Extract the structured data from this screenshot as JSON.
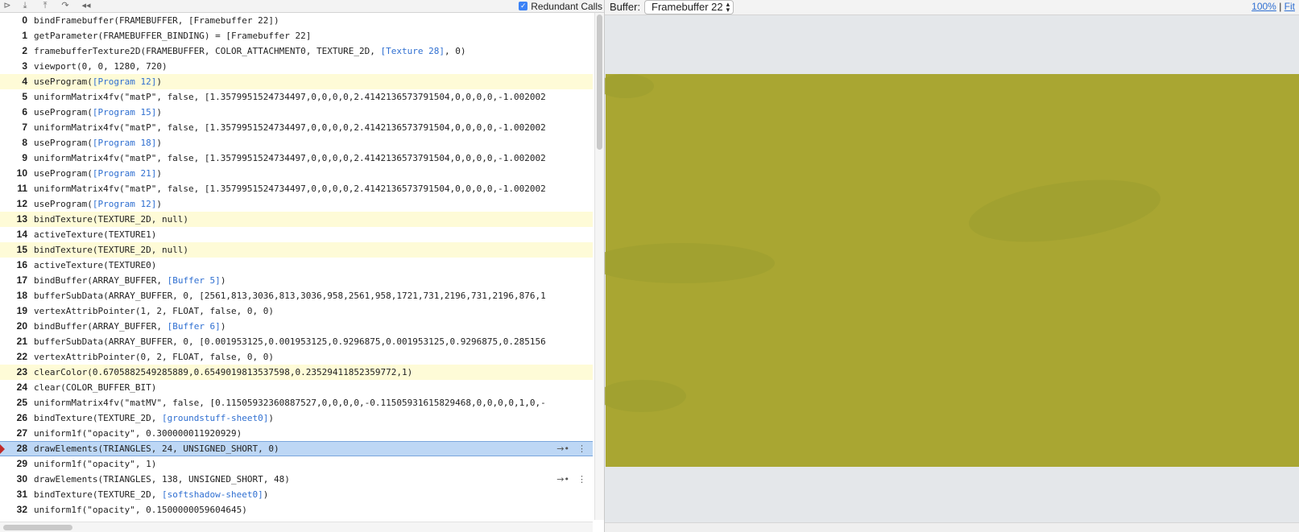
{
  "toolbar": {
    "buttons": [
      "step-forward-icon",
      "step-into-icon",
      "step-out-icon",
      "redo-icon",
      "rewind-icon"
    ],
    "redundant_calls_label": "Redundant Calls",
    "redundant_calls_checked": true
  },
  "calls": [
    {
      "num": "0",
      "code": [
        {
          "t": "bindFramebuffer(FRAMEBUFFER, [Framebuffer 22])"
        }
      ]
    },
    {
      "num": "1",
      "code": [
        {
          "t": "getParameter(FRAMEBUFFER_BINDING) = [Framebuffer 22]"
        }
      ]
    },
    {
      "num": "2",
      "code": [
        {
          "t": "framebufferTexture2D(FRAMEBUFFER, COLOR_ATTACHMENT0, TEXTURE_2D, "
        },
        {
          "t": "[Texture 28]",
          "ref": true
        },
        {
          "t": ", 0)"
        }
      ]
    },
    {
      "num": "3",
      "code": [
        {
          "t": "viewport(0, 0, 1280, 720)"
        }
      ]
    },
    {
      "num": "4",
      "hl": true,
      "code": [
        {
          "t": "useProgram("
        },
        {
          "t": "[Program 12]",
          "ref": true
        },
        {
          "t": ")"
        }
      ]
    },
    {
      "num": "5",
      "code": [
        {
          "t": "uniformMatrix4fv(\"matP\", false, [1.3579951524734497,0,0,0,0,2.4142136573791504,0,0,0,0,-1.002002"
        }
      ]
    },
    {
      "num": "6",
      "code": [
        {
          "t": "useProgram("
        },
        {
          "t": "[Program 15]",
          "ref": true
        },
        {
          "t": ")"
        }
      ]
    },
    {
      "num": "7",
      "code": [
        {
          "t": "uniformMatrix4fv(\"matP\", false, [1.3579951524734497,0,0,0,0,2.4142136573791504,0,0,0,0,-1.002002"
        }
      ]
    },
    {
      "num": "8",
      "code": [
        {
          "t": "useProgram("
        },
        {
          "t": "[Program 18]",
          "ref": true
        },
        {
          "t": ")"
        }
      ]
    },
    {
      "num": "9",
      "code": [
        {
          "t": "uniformMatrix4fv(\"matP\", false, [1.3579951524734497,0,0,0,0,2.4142136573791504,0,0,0,0,-1.002002"
        }
      ]
    },
    {
      "num": "10",
      "code": [
        {
          "t": "useProgram("
        },
        {
          "t": "[Program 21]",
          "ref": true
        },
        {
          "t": ")"
        }
      ]
    },
    {
      "num": "11",
      "code": [
        {
          "t": "uniformMatrix4fv(\"matP\", false, [1.3579951524734497,0,0,0,0,2.4142136573791504,0,0,0,0,-1.002002"
        }
      ]
    },
    {
      "num": "12",
      "code": [
        {
          "t": "useProgram("
        },
        {
          "t": "[Program 12]",
          "ref": true
        },
        {
          "t": ")"
        }
      ]
    },
    {
      "num": "13",
      "hl": true,
      "code": [
        {
          "t": "bindTexture(TEXTURE_2D, null)"
        }
      ]
    },
    {
      "num": "14",
      "code": [
        {
          "t": "activeTexture(TEXTURE1)"
        }
      ]
    },
    {
      "num": "15",
      "hl": true,
      "code": [
        {
          "t": "bindTexture(TEXTURE_2D, null)"
        }
      ]
    },
    {
      "num": "16",
      "code": [
        {
          "t": "activeTexture(TEXTURE0)"
        }
      ]
    },
    {
      "num": "17",
      "code": [
        {
          "t": "bindBuffer(ARRAY_BUFFER, "
        },
        {
          "t": "[Buffer 5]",
          "ref": true
        },
        {
          "t": ")"
        }
      ]
    },
    {
      "num": "18",
      "code": [
        {
          "t": "bufferSubData(ARRAY_BUFFER, 0, [2561,813,3036,813,3036,958,2561,958,1721,731,2196,731,2196,876,1"
        }
      ]
    },
    {
      "num": "19",
      "code": [
        {
          "t": "vertexAttribPointer(1, 2, FLOAT, false, 0, 0)"
        }
      ]
    },
    {
      "num": "20",
      "code": [
        {
          "t": "bindBuffer(ARRAY_BUFFER, "
        },
        {
          "t": "[Buffer 6]",
          "ref": true
        },
        {
          "t": ")"
        }
      ]
    },
    {
      "num": "21",
      "code": [
        {
          "t": "bufferSubData(ARRAY_BUFFER, 0, [0.001953125,0.001953125,0.9296875,0.001953125,0.9296875,0.285156"
        }
      ]
    },
    {
      "num": "22",
      "code": [
        {
          "t": "vertexAttribPointer(0, 2, FLOAT, false, 0, 0)"
        }
      ]
    },
    {
      "num": "23",
      "hl": true,
      "code": [
        {
          "t": "clearColor(0.6705882549285889,0.6549019813537598,0.23529411852359772,1)"
        }
      ]
    },
    {
      "num": "24",
      "code": [
        {
          "t": "clear(COLOR_BUFFER_BIT)"
        }
      ]
    },
    {
      "num": "25",
      "code": [
        {
          "t": "uniformMatrix4fv(\"matMV\", false, [0.11505932360887527,0,0,0,0,-0.11505931615829468,0,0,0,0,1,0,-"
        }
      ]
    },
    {
      "num": "26",
      "code": [
        {
          "t": "bindTexture(TEXTURE_2D, "
        },
        {
          "t": "[groundstuff-sheet0]",
          "ref": true
        },
        {
          "t": ")"
        }
      ]
    },
    {
      "num": "27",
      "code": [
        {
          "t": "uniform1f(\"opacity\", 0.300000011920929)"
        }
      ]
    },
    {
      "num": "28",
      "sel": true,
      "bp": true,
      "acts": true,
      "code": [
        {
          "t": "drawElements(TRIANGLES, 24, UNSIGNED_SHORT, 0)"
        }
      ]
    },
    {
      "num": "29",
      "code": [
        {
          "t": "uniform1f(\"opacity\", 1)"
        }
      ]
    },
    {
      "num": "30",
      "acts": true,
      "code": [
        {
          "t": "drawElements(TRIANGLES, 138, UNSIGNED_SHORT, 48)"
        }
      ]
    },
    {
      "num": "31",
      "code": [
        {
          "t": "bindTexture(TEXTURE_2D, "
        },
        {
          "t": "[softshadow-sheet0]",
          "ref": true
        },
        {
          "t": ")"
        }
      ]
    },
    {
      "num": "32",
      "code": [
        {
          "t": "uniform1f(\"opacity\", 0.1500000059604645)"
        }
      ]
    }
  ],
  "row_actions": {
    "goto_icon": "→•",
    "info_icon": "⋮"
  },
  "buffer": {
    "label": "Buffer:",
    "selected": "Framebuffer 22",
    "zoom_100": "100%",
    "separator": "|",
    "zoom_fit": "Fit",
    "fill_color": "#a9a632"
  }
}
